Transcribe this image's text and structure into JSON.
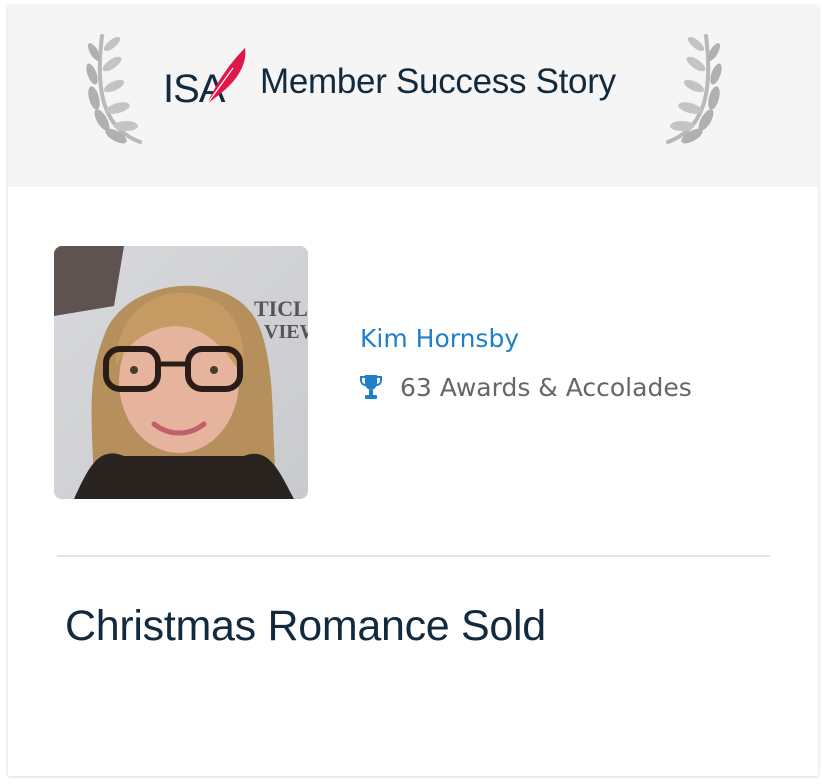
{
  "header": {
    "logo_text": "ISA",
    "title": "Member Success Story"
  },
  "member": {
    "name": "Kim Hornsby",
    "awards": "63 Awards & Accolades",
    "photo_icon": "member-portrait"
  },
  "story": {
    "title": "Christmas Romance Sold"
  },
  "colors": {
    "header_bg": "#f5f5f5",
    "navy": "#122a3e",
    "link_blue": "#1f7fc7",
    "accent_red": "#e0174a",
    "trophy_blue": "#1f7fc7",
    "laurel_gray": "#b9b9b9"
  }
}
